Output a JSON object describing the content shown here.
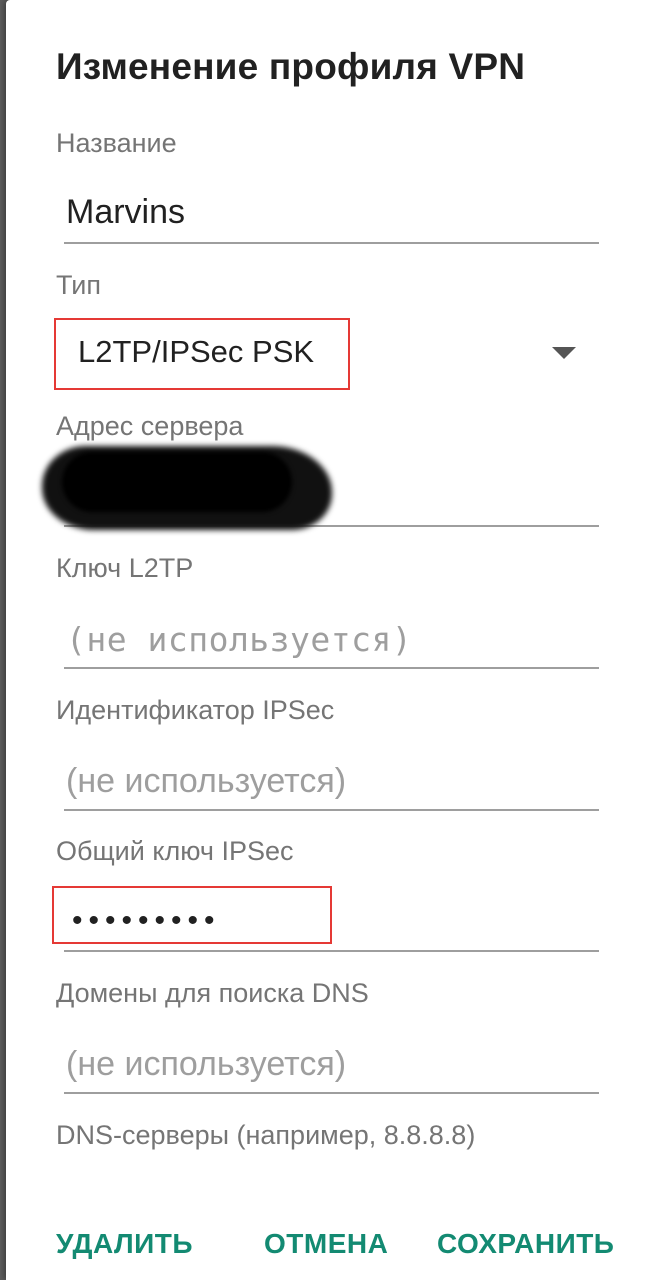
{
  "dialog": {
    "title": "Изменение профиля VPN"
  },
  "fields": {
    "name": {
      "label": "Название",
      "value": "Marvins"
    },
    "type": {
      "label": "Тип",
      "value": "L2TP/IPSec PSK"
    },
    "server": {
      "label": "Адрес сервера",
      "value": ""
    },
    "l2tp_key": {
      "label": "Ключ L2TP",
      "placeholder": "(не используется)"
    },
    "ipsec_id": {
      "label": "Идентификатор IPSec",
      "placeholder": "(не используется)"
    },
    "ipsec_psk": {
      "label": "Общий ключ IPSec",
      "value": "•••••••••"
    },
    "dns_domains": {
      "label": "Домены для поиска DNS",
      "placeholder": "(не используется)"
    },
    "dns_servers": {
      "label": "DNS-серверы (например, 8.8.8.8)"
    }
  },
  "actions": {
    "delete": "УДАЛИТЬ",
    "cancel": "ОТМЕНА",
    "save": "СОХРАНИТЬ"
  },
  "colors": {
    "accent": "#138a72",
    "highlight": "#e53935",
    "label": "#757575",
    "text": "#212121"
  }
}
